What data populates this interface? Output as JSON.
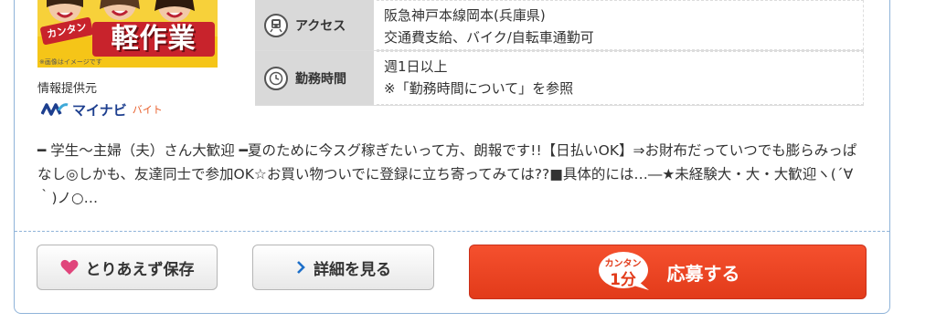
{
  "thumbnail": {
    "small_logo": "カンタン",
    "big_logo": "軽作業",
    "caption": "※画像はイメージです"
  },
  "provider": {
    "label": "情報提供元",
    "name": "マイナビ",
    "sub": "バイト"
  },
  "info": [
    {
      "icon": "train-icon",
      "label": "アクセス",
      "lines": [
        "阪急神戸本線岡本(兵庫県)",
        "交通費支給、バイク/自転車通勤可"
      ]
    },
    {
      "icon": "clock-icon",
      "label": "勤務時間",
      "lines": [
        "週1日以上",
        "※「勤務時間について」を参照"
      ]
    }
  ],
  "description": "━ 学生〜主婦（夫）さん大歓迎 ━夏のために今スグ稼ぎたいって方、朗報です!!【日払いOK】⇒お財布だっていつでも膨らみっぱなし◎しかも、友達同士で参加OK☆お買い物ついでに登録に立ち寄ってみては??■具体的には…―★未経験大・大・大歓迎ヽ(´∀｀)ノ○…",
  "buttons": {
    "save_label": "とりあえず保存",
    "detail_label": "詳細を見る",
    "apply_label": "応募する",
    "badge_top": "カンタン",
    "badge_main": "1分"
  },
  "colors": {
    "accent_red": "#e23b1a",
    "border_blue": "#8fb3d9",
    "heart_pink": "#e0457b",
    "chevron_blue": "#1d6fc9"
  }
}
